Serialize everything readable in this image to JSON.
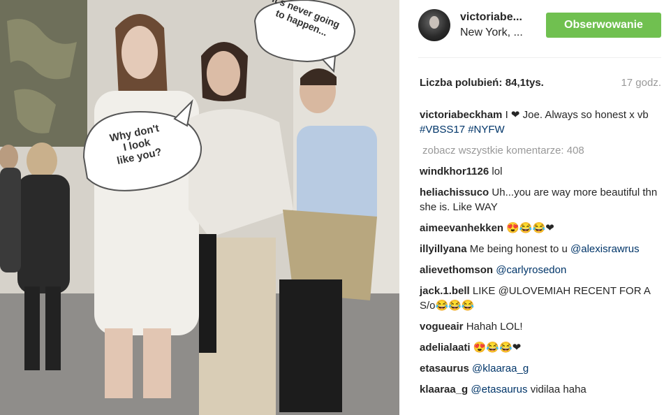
{
  "photo": {
    "bubble_left": "Why don't\nI look\nlike you?",
    "bubble_right": "It's never going\nto happen..."
  },
  "header": {
    "username": "victoriabe...",
    "location": "New York, ...",
    "follow_button": "Obserwowanie"
  },
  "stats": {
    "likes_label": "Liczba polubień:",
    "likes_value": "84,1tys.",
    "timestamp": "17 godz."
  },
  "caption": {
    "user": "victoriabeckham",
    "text": "I ❤ Joe. Always so honest x vb",
    "tags": [
      "#VBSS17",
      "#NYFW"
    ]
  },
  "view_all_comments": "zobacz wszystkie komentarze: 408",
  "comments": [
    {
      "user": "windkhor1126",
      "text": "lol",
      "mention": ""
    },
    {
      "user": "heliachissuco",
      "text": "Uh...you are way more beautiful thn she is. Like WAY",
      "mention": ""
    },
    {
      "user": "aimeevanhekken",
      "text": "😍😂😂❤",
      "mention": ""
    },
    {
      "user": "illyillyana",
      "text": "Me being honest to u",
      "mention": "@alexisrawrus"
    },
    {
      "user": "alievethomson",
      "text": "",
      "mention": "@carlyrosedon"
    },
    {
      "user": "jack.1.bell",
      "text": "LIKE @ULOVEMIAH RECENT FOR A S/o😂😂😂",
      "mention": ""
    },
    {
      "user": "vogueair",
      "text": "Hahah LOL!",
      "mention": ""
    },
    {
      "user": "adelialaati",
      "text": "😍😂😂❤",
      "mention": ""
    },
    {
      "user": "etasaurus",
      "text": "",
      "mention": "@klaaraa_g"
    },
    {
      "user": "klaaraa_g",
      "text": "vidilaa haha",
      "mention": "@etasaurus"
    }
  ]
}
